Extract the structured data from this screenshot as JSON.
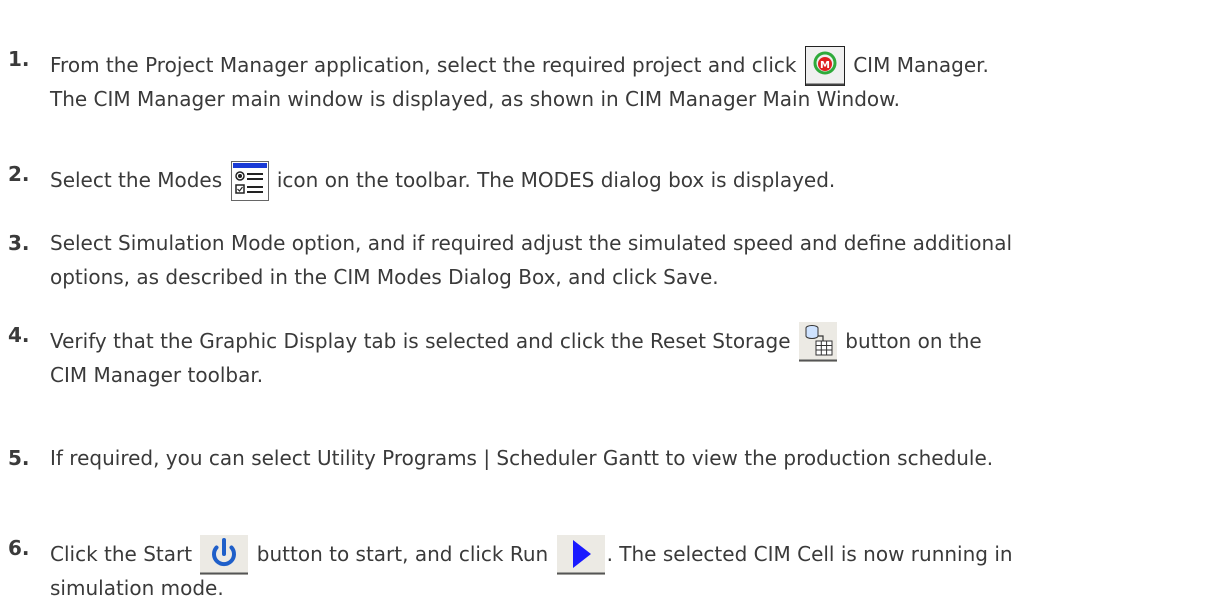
{
  "steps": [
    {
      "number": "1.",
      "text_a": "From the Project Manager application, select the required project and click",
      "icon": "cim-manager-icon",
      "text_b": "CIM Manager.",
      "line2": "The CIM Manager main window is displayed, as shown in CIM Manager Main Window."
    },
    {
      "number": "2.",
      "text_a": "Select the Modes",
      "icon": "modes-icon",
      "text_b": "icon on the toolbar. The MODES dialog box is displayed."
    },
    {
      "number": "3.",
      "line1": "Select Simulation Mode option, and if required adjust the simulated speed and define additional",
      "line2": "options, as described in the CIM Modes Dialog Box, and click Save."
    },
    {
      "number": "4.",
      "text_a": "Verify that the Graphic Display tab is selected and click the Reset Storage",
      "icon": "reset-storage-icon",
      "text_b": "button on the",
      "line2": "CIM Manager toolbar."
    },
    {
      "number": "5.",
      "line1": "If required, you can select Utility Programs | Scheduler Gantt to view the production schedule."
    },
    {
      "number": "6.",
      "text_a": "Click the Start",
      "icon_a": "start-power-icon",
      "text_b": "button to start, and click Run",
      "icon_b": "run-play-icon",
      "text_c": ". The selected CIM Cell is now running in",
      "line2": "simulation mode."
    }
  ],
  "colors": {
    "text": "#3a3a3a",
    "play_blue": "#1a1aff",
    "power_blue": "#1f5fc9"
  }
}
